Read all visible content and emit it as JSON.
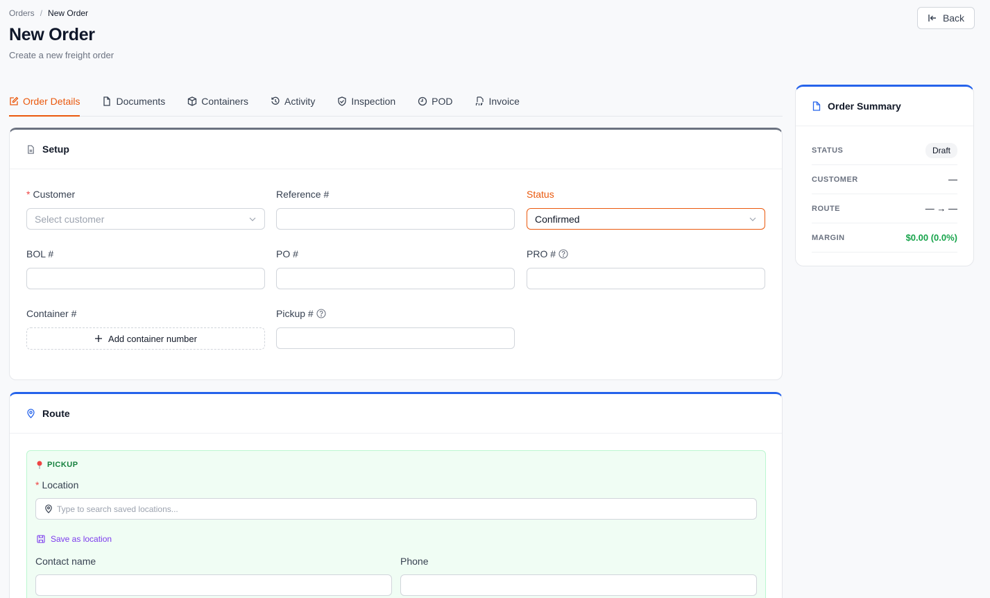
{
  "breadcrumb": {
    "parent": "Orders",
    "separator": "/",
    "current": "New Order"
  },
  "header": {
    "title": "New Order",
    "subtitle": "Create a new freight order",
    "back_label": "Back"
  },
  "tabs": [
    {
      "label": "Order Details",
      "icon": "edit-icon",
      "active": true
    },
    {
      "label": "Documents",
      "icon": "document-icon"
    },
    {
      "label": "Containers",
      "icon": "box-icon"
    },
    {
      "label": "Activity",
      "icon": "history-icon"
    },
    {
      "label": "Inspection",
      "icon": "shield-icon"
    },
    {
      "label": "POD",
      "icon": "clock-icon"
    },
    {
      "label": "Invoice",
      "icon": "pdf-icon"
    }
  ],
  "setup": {
    "title": "Setup",
    "customer_label": "Customer",
    "customer_placeholder": "Select customer",
    "reference_label": "Reference #",
    "reference_value": "",
    "status_label": "Status",
    "status_value": "Confirmed",
    "bol_label": "BOL #",
    "po_label": "PO #",
    "pro_label": "PRO #",
    "container_label": "Container #",
    "add_container_label": "Add container number",
    "pickup_num_label": "Pickup #",
    "required_mark": "*"
  },
  "route": {
    "title": "Route",
    "pickup_title": "PICKUP",
    "location_label": "Location",
    "location_placeholder": "Type to search saved locations...",
    "save_location_label": "Save as location",
    "contact_label": "Contact name",
    "phone_label": "Phone"
  },
  "summary": {
    "title": "Order Summary",
    "status_key": "STATUS",
    "status_value": "Draft",
    "customer_key": "CUSTOMER",
    "customer_value": "—",
    "route_key": "ROUTE",
    "route_value": "— → —",
    "margin_key": "MARGIN",
    "margin_value": "$0.00 (0.0%)"
  },
  "colors": {
    "accent": "#ea580c",
    "primary": "#2563eb",
    "success": "#16a34a"
  }
}
